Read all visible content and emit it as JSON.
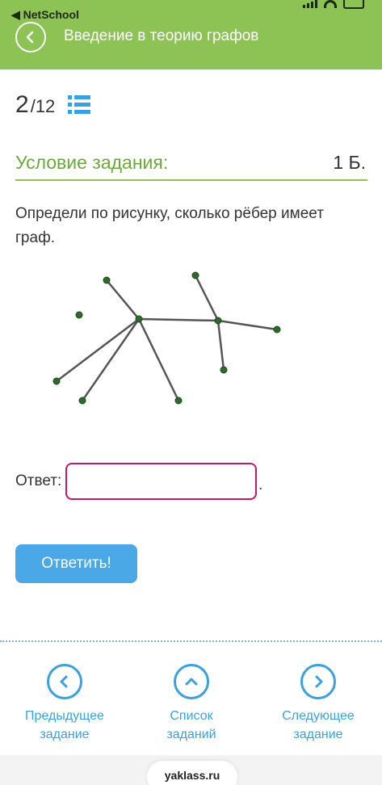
{
  "status_bar": {
    "back_app": "◀ NetSchool",
    "icons": [
      "signal-icon",
      "wifi-icon",
      "battery-icon"
    ]
  },
  "header": {
    "title": "Введение в теорию графов",
    "back_icon": "chevron-left-icon"
  },
  "progress": {
    "current": "2",
    "separator": "/",
    "total": "12",
    "icon": "list-icon"
  },
  "task": {
    "heading": "Условие задания:",
    "points": "1 Б.",
    "question": "Определи по рисунку, сколько рёбер имеет граф."
  },
  "graph_figure": {
    "vertex_count": 10,
    "edge_count": 8,
    "vertex_color": "#2e6b2a",
    "edge_color": "#555555"
  },
  "answer": {
    "label": "Ответ:",
    "value": "",
    "trailing": "."
  },
  "submit": {
    "label": "Ответить!"
  },
  "nav": {
    "prev": {
      "label_line1": "Предыдущее",
      "label_line2": "задание",
      "icon": "chevron-left-icon"
    },
    "list": {
      "label_line1": "Список",
      "label_line2": "заданий",
      "icon": "chevron-up-icon"
    },
    "next": {
      "label_line1": "Следующее",
      "label_line2": "задание",
      "icon": "chevron-right-icon"
    }
  },
  "site": "yaklass.ru",
  "colors": {
    "brand_green": "#8dc255",
    "accent_blue": "#3aa0df",
    "input_border": "#c2186b",
    "button_blue": "#4aa8e6"
  }
}
